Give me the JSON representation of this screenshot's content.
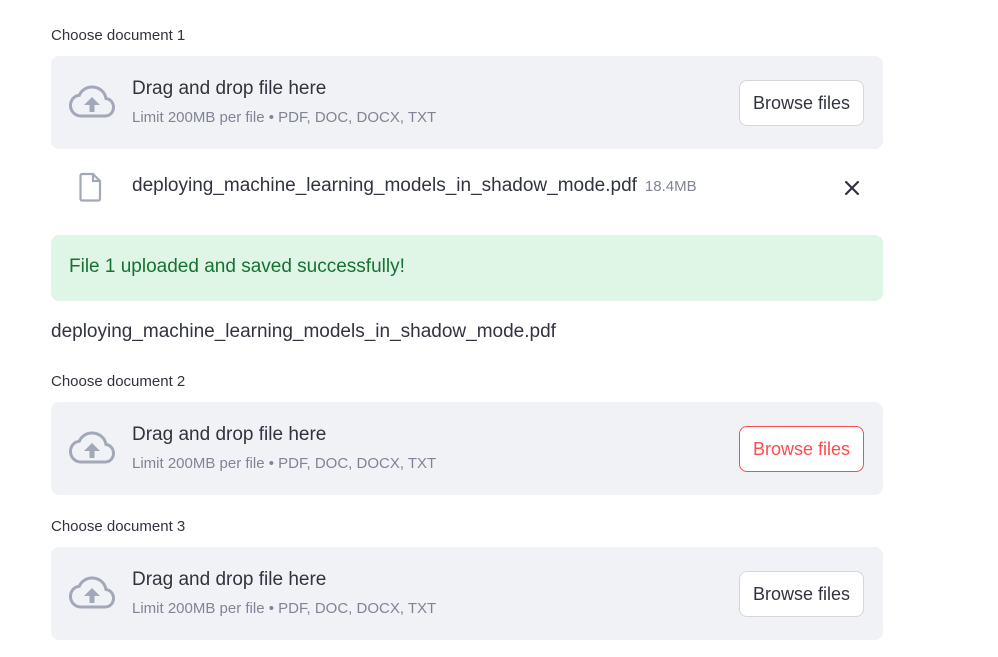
{
  "uploaders": [
    {
      "label": "Choose document 1",
      "dropzone_title": "Drag and drop file here",
      "dropzone_subtitle": "Limit 200MB per file • PDF, DOC, DOCX, TXT",
      "browse_label": "Browse files",
      "browse_state": "normal"
    },
    {
      "label": "Choose document 2",
      "dropzone_title": "Drag and drop file here",
      "dropzone_subtitle": "Limit 200MB per file • PDF, DOC, DOCX, TXT",
      "browse_label": "Browse files",
      "browse_state": "hover"
    },
    {
      "label": "Choose document 3",
      "dropzone_title": "Drag and drop file here",
      "dropzone_subtitle": "Limit 200MB per file • PDF, DOC, DOCX, TXT",
      "browse_label": "Browse files",
      "browse_state": "normal"
    }
  ],
  "uploaded_file": {
    "name": "deploying_machine_learning_models_in_shadow_mode.pdf",
    "size": "18.4MB",
    "icon": "file-icon",
    "remove_icon": "close-icon"
  },
  "success_message": "File 1 uploaded and saved successfully!",
  "displayed_filename": "deploying_machine_learning_models_in_shadow_mode.pdf",
  "colors": {
    "dropzone_bg": "#f0f2f6",
    "success_bg": "#dff5e6",
    "success_text": "#177233",
    "accent": "#ff4b4b",
    "muted_text": "#808495"
  }
}
